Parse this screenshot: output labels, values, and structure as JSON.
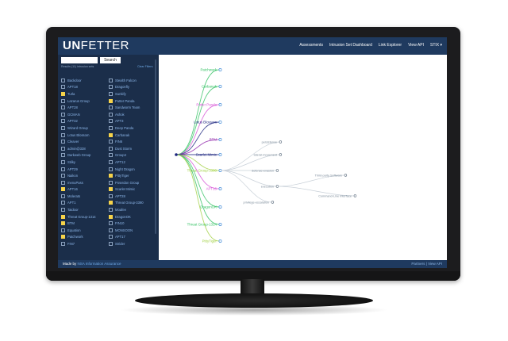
{
  "app": {
    "brand_prefix": "UN",
    "brand_rest": "FETTER"
  },
  "nav": [
    "Assessments",
    "Intrusion Set Dashboard",
    "Link Explorer",
    "View API",
    "STIX ▾"
  ],
  "sidebar": {
    "search_placeholder": "",
    "search_button": "Search",
    "results_text": "Results (11) intrusion sets",
    "clear_filters": "Clear Filters",
    "left_items": [
      {
        "label": "Backdoor",
        "checked": false
      },
      {
        "label": "APT18",
        "checked": false
      },
      {
        "label": "Turla",
        "checked": true
      },
      {
        "label": "Lazarus Group",
        "checked": false
      },
      {
        "label": "APT28",
        "checked": false
      },
      {
        "label": "GCMAN",
        "checked": false
      },
      {
        "label": "APT32",
        "checked": false
      },
      {
        "label": "Wizard Group",
        "checked": false
      },
      {
        "label": "Lotus Blossom",
        "checked": false
      },
      {
        "label": "Cleaver",
        "checked": false
      },
      {
        "label": "admin@338",
        "checked": false
      },
      {
        "label": "Darkweb Group",
        "checked": false
      },
      {
        "label": "Stilky",
        "checked": false
      },
      {
        "label": "APT29",
        "checked": false
      },
      {
        "label": "Naikon",
        "checked": false
      },
      {
        "label": "menuPass",
        "checked": false
      },
      {
        "label": "APT16",
        "checked": true
      },
      {
        "label": "Molerats",
        "checked": false
      },
      {
        "label": "APT1",
        "checked": false
      },
      {
        "label": "Taidoor",
        "checked": false
      },
      {
        "label": "Threat Group-1314",
        "checked": true
      },
      {
        "label": "BTM",
        "checked": true
      },
      {
        "label": "Equation",
        "checked": false
      },
      {
        "label": "Patchwork",
        "checked": true
      },
      {
        "label": "FIN7",
        "checked": false
      }
    ],
    "right_items": [
      {
        "label": "Stealth Falcon",
        "checked": false
      },
      {
        "label": "Dragonfly",
        "checked": false
      },
      {
        "label": "Sunkify",
        "checked": false
      },
      {
        "label": "Putter Panda",
        "checked": true
      },
      {
        "label": "Sandworm Team",
        "checked": false
      },
      {
        "label": "Ashok",
        "checked": false
      },
      {
        "label": "APT3",
        "checked": false
      },
      {
        "label": "Deep Panda",
        "checked": false
      },
      {
        "label": "Carbanak",
        "checked": true
      },
      {
        "label": "FIN6",
        "checked": false
      },
      {
        "label": "Dust Storm",
        "checked": false
      },
      {
        "label": "Group4",
        "checked": false
      },
      {
        "label": "APT12",
        "checked": false
      },
      {
        "label": "Night Dragon",
        "checked": false
      },
      {
        "label": "PittyTiger",
        "checked": true
      },
      {
        "label": "Poseidon Group",
        "checked": false
      },
      {
        "label": "Scarlet Mimic",
        "checked": true
      },
      {
        "label": "APT28",
        "checked": false
      },
      {
        "label": "Threat Group-3390",
        "checked": true
      },
      {
        "label": "Moafee",
        "checked": false
      },
      {
        "label": "DragonOK",
        "checked": true
      },
      {
        "label": "FIN10",
        "checked": false
      },
      {
        "label": "MONSOON",
        "checked": false
      },
      {
        "label": "APT17",
        "checked": false
      },
      {
        "label": "Strider",
        "checked": false
      }
    ]
  },
  "graph": {
    "nodes": [
      {
        "label": "Patchwork",
        "color": "#30c060"
      },
      {
        "label": "Carbanak",
        "color": "#30c060"
      },
      {
        "label": "Putter Panda",
        "color": "#d64fd6"
      },
      {
        "label": "Lotus Blossom",
        "color": "#1a237e"
      },
      {
        "label": "BTM",
        "color": "#8e24aa"
      },
      {
        "label": "Scarlet Mimic",
        "color": "#1a237e"
      },
      {
        "label": "Threat Group-3390",
        "color": "#a0d040"
      },
      {
        "label": "APT16",
        "color": "#d64fd6"
      },
      {
        "label": "DragonOK",
        "color": "#30c060"
      },
      {
        "label": "Threat Group-1314",
        "color": "#30c060"
      },
      {
        "label": "PittyTiger",
        "color": "#a0d040"
      }
    ],
    "sub_nodes": [
      "persistence",
      "lateral-movement",
      "defense-evasion",
      "execution",
      "privilege-escalation"
    ],
    "leaf_nodes": [
      "Third-party Software",
      "Command-Line Interface"
    ]
  },
  "footer": {
    "made_prefix": "Made by ",
    "made_link": "NSA Information Assurance",
    "links": "Partners  |  View API"
  }
}
